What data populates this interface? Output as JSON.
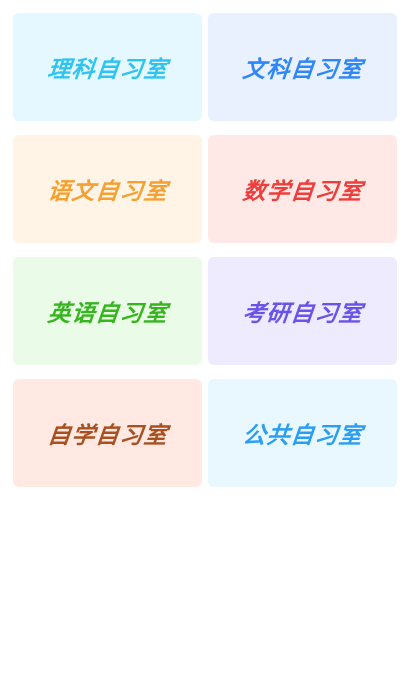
{
  "rooms": [
    {
      "label": "理科自习室",
      "bg": "#e6f8ff",
      "color": "#2ec4f0"
    },
    {
      "label": "文科自习室",
      "bg": "#e9f1ff",
      "color": "#2f86f5"
    },
    {
      "label": "语文自习室",
      "bg": "#fff4e5",
      "color": "#f5a030"
    },
    {
      "label": "数学自习室",
      "bg": "#ffe9e7",
      "color": "#ee3d3a"
    },
    {
      "label": "英语自习室",
      "bg": "#eafbe7",
      "color": "#36b51e"
    },
    {
      "label": "考研自习室",
      "bg": "#eeebff",
      "color": "#6a53e8"
    },
    {
      "label": "自学自习室",
      "bg": "#ffe9e2",
      "color": "#a8501f"
    },
    {
      "label": "公共自习室",
      "bg": "#e9f7ff",
      "color": "#2a9ef0"
    }
  ]
}
